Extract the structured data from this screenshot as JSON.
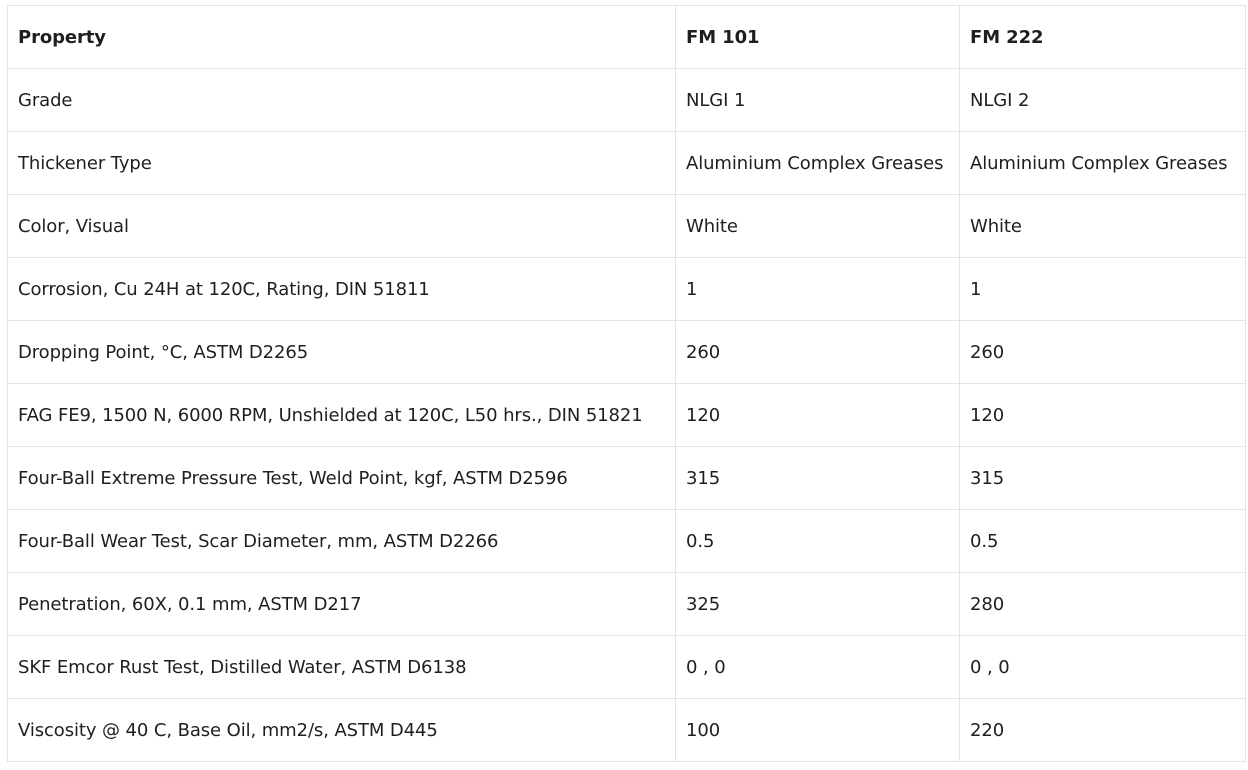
{
  "table": {
    "headers": [
      "Property",
      "FM 101",
      "FM 222"
    ],
    "rows": [
      [
        "Grade",
        "NLGI 1",
        "NLGI 2"
      ],
      [
        "Thickener Type",
        "Aluminium Complex Greases",
        "Aluminium Complex Greases"
      ],
      [
        "Color, Visual",
        "White",
        "White"
      ],
      [
        "Corrosion, Cu 24H at 120C, Rating, DIN 51811",
        "1",
        "1"
      ],
      [
        "Dropping Point, °C, ASTM D2265",
        "260",
        "260"
      ],
      [
        "FAG FE9, 1500 N, 6000 RPM, Unshielded at 120C, L50 hrs., DIN 51821",
        "120",
        "120"
      ],
      [
        "Four-Ball Extreme Pressure Test, Weld Point, kgf, ASTM D2596",
        "315",
        "315"
      ],
      [
        "Four-Ball Wear Test, Scar Diameter, mm, ASTM D2266",
        "0.5",
        "0.5"
      ],
      [
        "Penetration, 60X, 0.1 mm, ASTM D217",
        "325",
        "280"
      ],
      [
        "SKF Emcor Rust Test, Distilled Water, ASTM D6138",
        "0 , 0",
        "0 , 0"
      ],
      [
        "Viscosity @ 40 C, Base Oil, mm2/s, ASTM D445",
        "100",
        "220"
      ]
    ]
  }
}
